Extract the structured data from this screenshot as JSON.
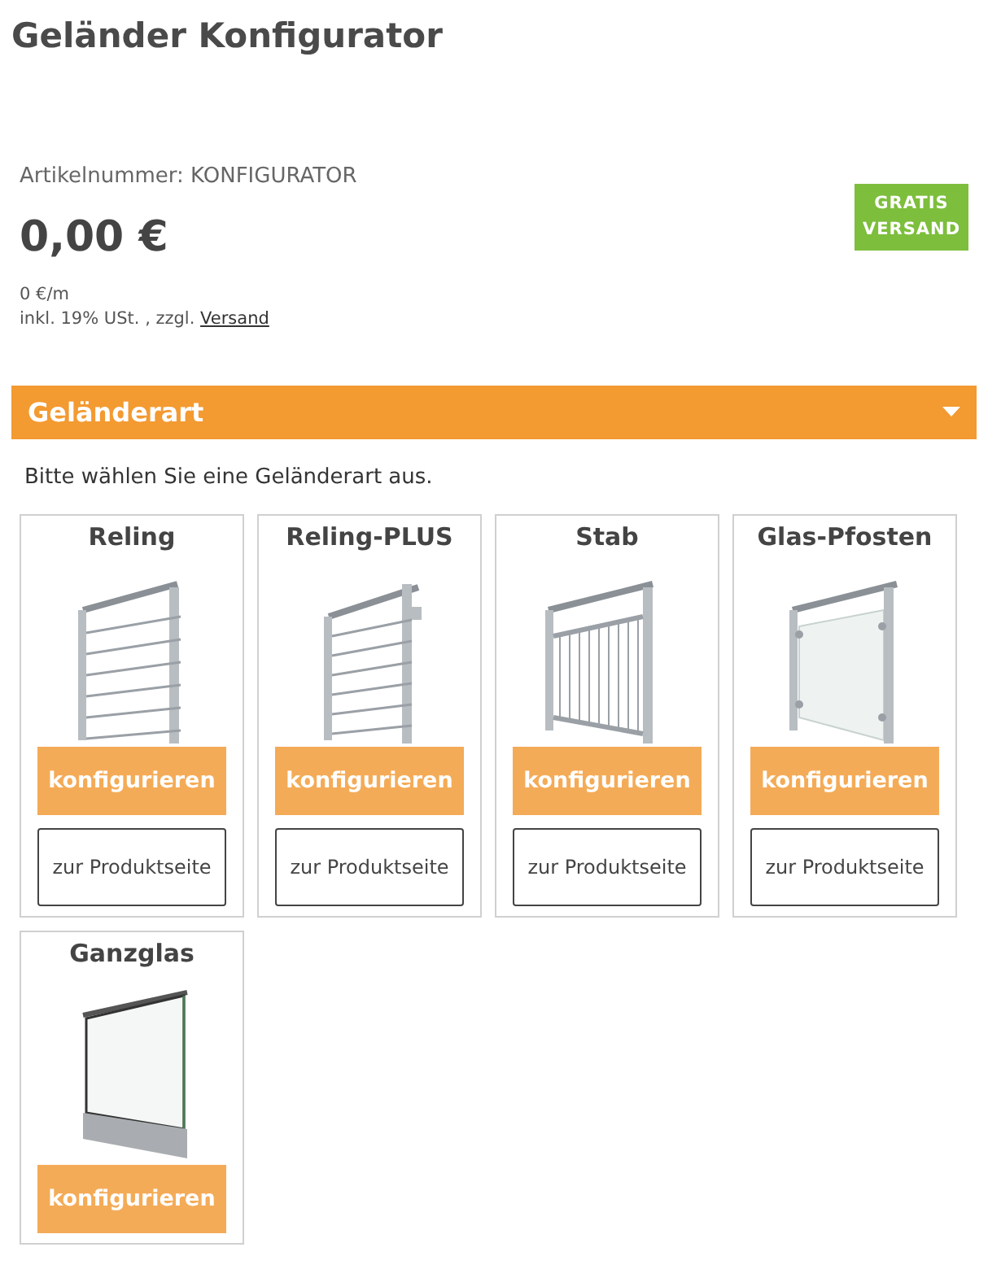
{
  "page_title": "Geländer Konfigurator",
  "product": {
    "article_number": "Artikelnummer: KONFIGURATOR",
    "price": "0,00 €",
    "unit_price": "0 €/m",
    "tax_note": "inkl. 19% USt. , zzgl.",
    "shipping_link": "Versand",
    "badge": "GRATIS VERSAND"
  },
  "section": {
    "title": "Geländerart",
    "expanded": true,
    "instruction": "Bitte wählen Sie eine Geländerart aus."
  },
  "railing_types": [
    {
      "name": "Reling",
      "kind": "reling",
      "configure_button": "konfigurieren",
      "product_button": "zur Produktseite"
    },
    {
      "name": "Reling-PLUS",
      "kind": "relingplus",
      "configure_button": "konfigurieren",
      "product_button": "zur Produktseite"
    },
    {
      "name": "Stab",
      "kind": "stab",
      "configure_button": "konfigurieren",
      "product_button": "zur Produktseite"
    },
    {
      "name": "Glas-Pfosten",
      "kind": "glaspfosten",
      "configure_button": "konfigurieren",
      "product_button": "zur Produktseite"
    },
    {
      "name": "Ganzglas",
      "kind": "ganzglas",
      "configure_button": "konfigurieren"
    }
  ]
}
